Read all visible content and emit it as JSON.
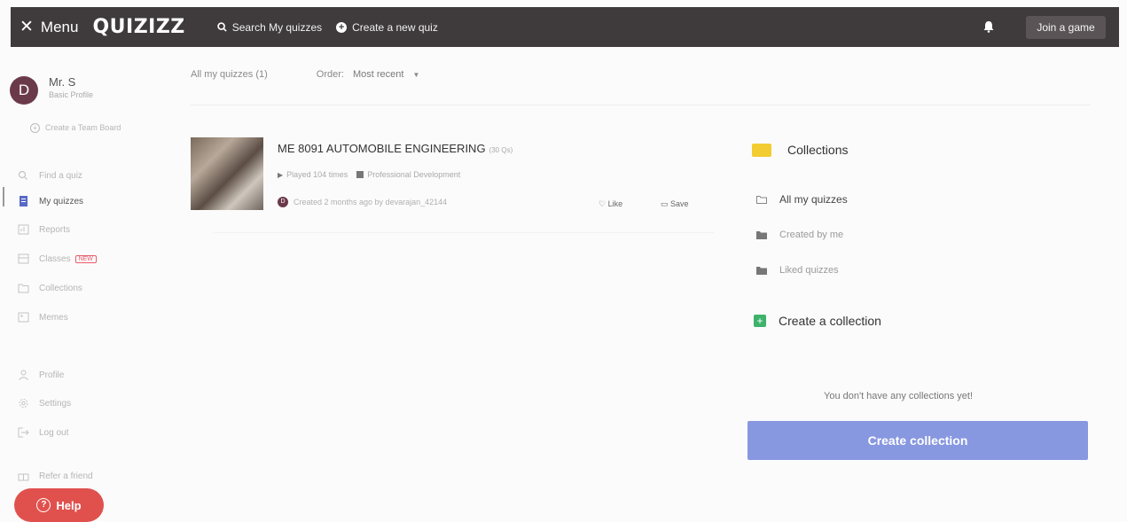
{
  "header": {
    "menu_label": "Menu",
    "logo": "QUIZIZZ",
    "search_label": "Search My quizzes",
    "create_label": "Create a new quiz",
    "join_label": "Join a game"
  },
  "sidebar": {
    "user_initial": "D",
    "user_name": "Mr. S",
    "user_sub": "Basic Profile",
    "create_team": "Create a Team Board",
    "items": [
      {
        "label": "Find a quiz",
        "icon": "search-icon"
      },
      {
        "label": "My quizzes",
        "icon": "quiz-icon"
      },
      {
        "label": "Reports",
        "icon": "reports-icon"
      },
      {
        "label": "Classes",
        "icon": "classes-icon",
        "badge": "NEW"
      },
      {
        "label": "Collections",
        "icon": "folder-icon"
      },
      {
        "label": "Memes",
        "icon": "memes-icon"
      },
      {
        "label": "Profile",
        "icon": "profile-icon"
      },
      {
        "label": "Settings",
        "icon": "gear-icon"
      },
      {
        "label": "Log out",
        "icon": "logout-icon"
      },
      {
        "label": "Refer a friend",
        "icon": "gift-icon"
      }
    ],
    "help_label": "Help"
  },
  "filters": {
    "all_label": "All my quizzes (1)",
    "order_label": "Order:",
    "order_value": "Most recent"
  },
  "quiz": {
    "title": "ME 8091 AUTOMOBILE ENGINEERING",
    "count": "(30 Qs)",
    "played": "Played 104 times",
    "category": "Professional Development",
    "creator_initial": "D",
    "created": "Created 2 months ago by devarajan_42144",
    "like_label": "Like",
    "save_label": "Save"
  },
  "collections": {
    "title": "Collections",
    "items": [
      "All my quizzes",
      "Created by me",
      "Liked quizzes"
    ],
    "create_label": "Create a collection",
    "empty_message": "You don't have any collections yet!",
    "button_label": "Create collection"
  }
}
